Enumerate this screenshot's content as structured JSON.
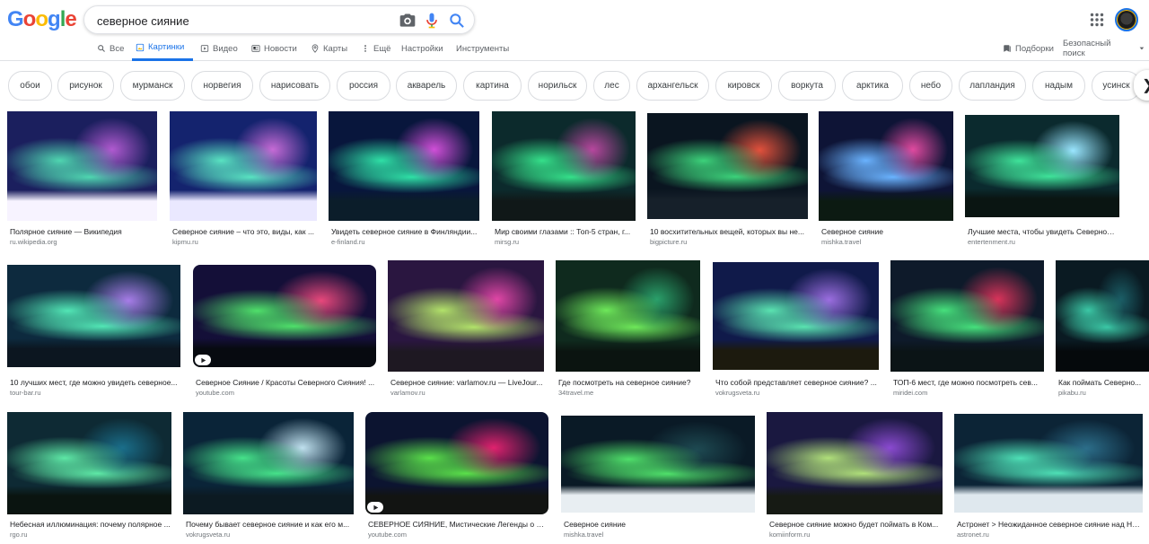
{
  "header": {
    "logo": [
      "G",
      "o",
      "o",
      "g",
      "l",
      "e"
    ],
    "search_value": "северное сияние"
  },
  "tabs": [
    "Все",
    "Картинки",
    "Видео",
    "Новости",
    "Карты",
    "Ещё",
    "Настройки",
    "Инструменты"
  ],
  "right_links": {
    "collections": "Подборки",
    "safesearch": "Безопасный поиск"
  },
  "chips": [
    "обои",
    "рисунок",
    "мурманск",
    "норвегия",
    "нарисовать",
    "россия",
    "акварель",
    "картина",
    "норильск",
    "лес",
    "архангельск",
    "кировск",
    "воркута",
    "арктика",
    "небо",
    "лапландия",
    "надым",
    "усинск"
  ],
  "results": [
    {
      "caption": "Полярное сияние — Википедия",
      "source": "ru.wikipedia.org",
      "colors": [
        "#1b1f5e",
        "#4fd6b0",
        "#b05ad0",
        "#f7f3ff"
      ]
    },
    {
      "caption": "Северное сияние – что это, виды, как ...",
      "source": "kipmu.ru",
      "colors": [
        "#14236e",
        "#59e3c1",
        "#c66bd6",
        "#eae8ff"
      ]
    },
    {
      "caption": "Увидеть северное сияние в Финляндии...",
      "source": "e-finland.ru",
      "colors": [
        "#08163c",
        "#2fe0a6",
        "#d04fd8",
        "#0b1d2a"
      ]
    },
    {
      "caption": "Мир своими глазами :: Топ-5 стран, г...",
      "source": "mirsg.ru",
      "colors": [
        "#0c2a2c",
        "#35e08a",
        "#b7479e",
        "#101818"
      ]
    },
    {
      "caption": "10 восхитительных вещей, которых вы не...",
      "source": "bigpicture.ru",
      "colors": [
        "#0a1520",
        "#3cd27a",
        "#e2513c",
        "#16202a"
      ]
    },
    {
      "caption": "Северное сияние",
      "source": "mishka.travel",
      "colors": [
        "#0e1436",
        "#6ab3ff",
        "#e04aa0",
        "#0c1a12"
      ]
    },
    {
      "caption": "Лучшие места, чтобы увидеть Северное Сияни...",
      "source": "entertenment.ru",
      "colors": [
        "#0b2a2e",
        "#3fe39a",
        "#9ae6ff",
        "#0a1512"
      ]
    },
    {
      "caption": "10 лучших мест, где можно увидеть северное...",
      "source": "tour-bar.ru",
      "colors": [
        "#0d2a3e",
        "#52e6b5",
        "#a77de8",
        "#0c1620"
      ]
    },
    {
      "caption": "Северное Сияние / Красоты Северного Сияния! ...",
      "source": "youtube.com",
      "colors": [
        "#140f38",
        "#4fe06a",
        "#e8487c",
        "#070a10"
      ]
    },
    {
      "caption": "Северное сияние: varlamov.ru — LiveJour...",
      "source": "varlamov.ru",
      "colors": [
        "#2a1640",
        "#b2e26a",
        "#e046a6",
        "#1e1822"
      ]
    },
    {
      "caption": "Где посмотреть на северное сияние?",
      "source": "34travel.me",
      "colors": [
        "#0f2a1e",
        "#6ee85a",
        "#2aa06a",
        "#0b1410"
      ]
    },
    {
      "caption": "Что собой представляет северное сияние? ...",
      "source": "vokrugsveta.ru",
      "colors": [
        "#101a4a",
        "#5ae3b0",
        "#9b6ee0",
        "#1c1a0e"
      ]
    },
    {
      "caption": "ТОП-6 мест, где можно посмотреть сев...",
      "source": "miridei.com",
      "colors": [
        "#0e1a2a",
        "#46e07c",
        "#d8335a",
        "#0b1416"
      ]
    },
    {
      "caption": "Как поймать Северно...",
      "source": "pikabu.ru",
      "colors": [
        "#0a1a22",
        "#3bc8a6",
        "#1b5e66",
        "#05090c"
      ]
    },
    {
      "caption": "Небесная иллюминация: почему полярное ...",
      "source": "rgo.ru",
      "colors": [
        "#0e2a34",
        "#5ee8a6",
        "#1a6e8a",
        "#0a1410"
      ]
    },
    {
      "caption": "Почему бывает северное сияние и как его м...",
      "source": "vokrugsveta.ru",
      "colors": [
        "#0a2438",
        "#46e28a",
        "#bfe0ee",
        "#0c1a22"
      ]
    },
    {
      "caption": "СЕВЕРНОЕ СИЯНИЕ, Мистические Легенды о Се...",
      "source": "youtube.com",
      "colors": [
        "#0c1430",
        "#5ae04a",
        "#e0226e",
        "#121412"
      ]
    },
    {
      "caption": "Северное сияние",
      "source": "mishka.travel",
      "colors": [
        "#0a1a26",
        "#4fe06a",
        "#1e4a52",
        "#e8eef2"
      ]
    },
    {
      "caption": "Северное сияние можно будет поймать в Ком...",
      "source": "komiinform.ru",
      "colors": [
        "#1a1840",
        "#b0e07a",
        "#8a4ad0",
        "#161a14"
      ]
    },
    {
      "caption": "Астронет > Неожиданное северное сияние над Но...",
      "source": "astronet.ru",
      "colors": [
        "#0c2436",
        "#4ee0b6",
        "#2c6e8a",
        "#dfe8ee"
      ]
    }
  ]
}
